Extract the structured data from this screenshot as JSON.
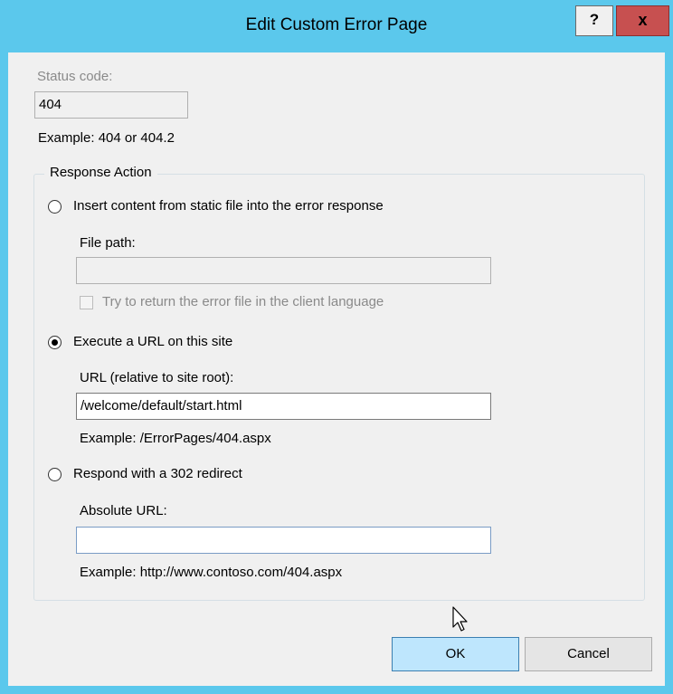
{
  "window": {
    "title": "Edit Custom Error Page",
    "help_label": "?",
    "close_label": "x"
  },
  "status_code": {
    "label": "Status code:",
    "value": "404",
    "example": "Example: 404 or 404.2"
  },
  "response_action": {
    "group_title": "Response Action",
    "static_file": {
      "label": "Insert content from static file into the error response",
      "selected": false,
      "file_path_label": "File path:",
      "file_path_value": "",
      "client_language_label": "Try to return the error file in the client language",
      "client_language_checked": false
    },
    "execute_url": {
      "label": "Execute a URL on this site",
      "selected": true,
      "url_label": "URL (relative to site root):",
      "url_value": "/welcome/default/start.html",
      "example": "Example: /ErrorPages/404.aspx"
    },
    "redirect": {
      "label": "Respond with a 302 redirect",
      "selected": false,
      "absolute_url_label": "Absolute URL:",
      "absolute_url_value": "",
      "example": "Example: http://www.contoso.com/404.aspx"
    }
  },
  "buttons": {
    "ok_label": "OK",
    "cancel_label": "Cancel"
  },
  "colors": {
    "title_bar": "#5bc8ec",
    "close_button": "#c75050",
    "ok_button": "#bee6fd",
    "dialog_background": "#f0f0f0"
  },
  "icons": {
    "cursor": "arrow-pointer-icon"
  }
}
